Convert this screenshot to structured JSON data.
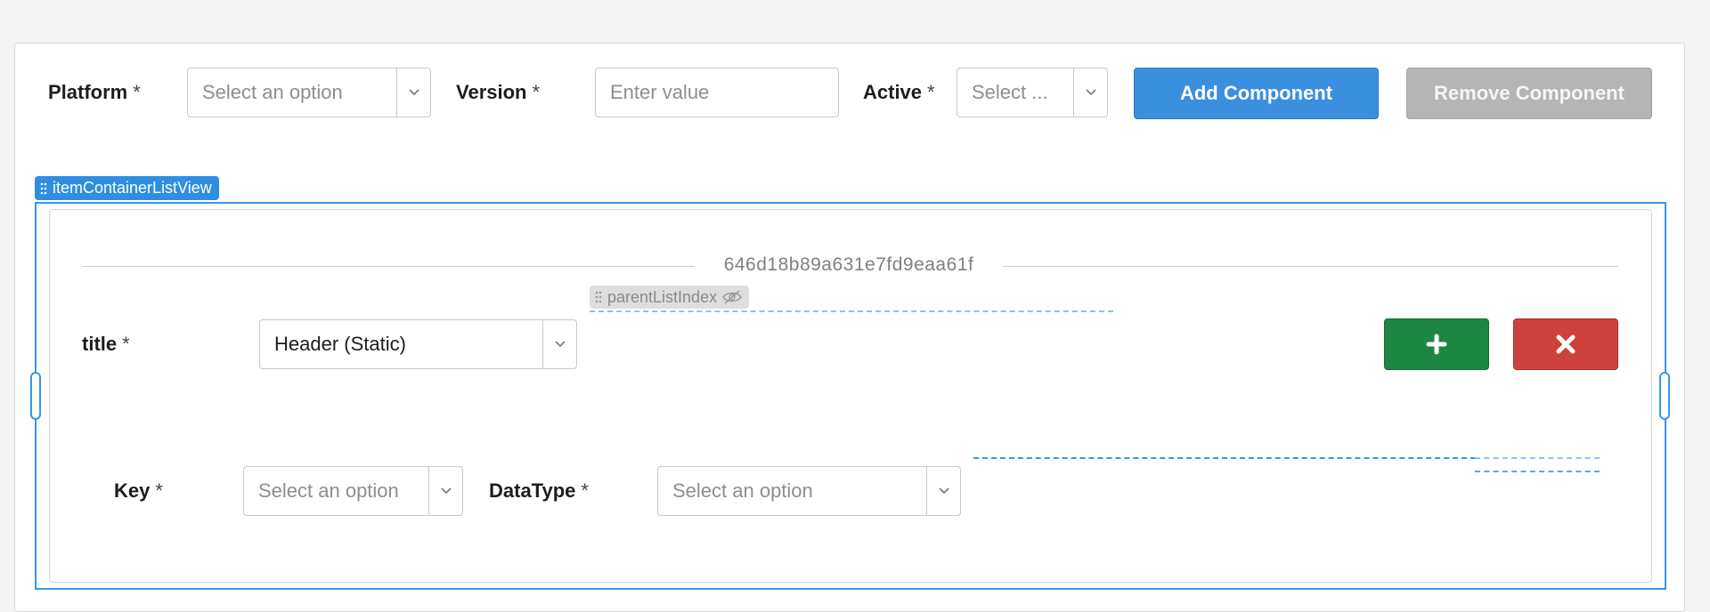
{
  "header": {
    "platform": {
      "label": "Platform",
      "required": "*",
      "placeholder": "Select an option"
    },
    "version": {
      "label": "Version",
      "required": "*",
      "placeholder": "Enter value"
    },
    "active": {
      "label": "Active",
      "required": "*",
      "placeholder": "Select ..."
    },
    "add_component_label": "Add Component",
    "remove_component_label": "Remove Component"
  },
  "list_view": {
    "tag": "itemContainerListView",
    "item": {
      "id": "646d18b89a631e7fd9eaa61f",
      "parent_tag": "parentListIndex",
      "title": {
        "label": "title",
        "required": "*",
        "value": "Header (Static)"
      },
      "key": {
        "label": "Key",
        "required": "*",
        "placeholder": "Select an option"
      },
      "datatype": {
        "label": "DataType",
        "required": "*",
        "placeholder": "Select an option"
      }
    }
  },
  "colors": {
    "primary": "#3a8fdf",
    "disabled": "#b5b5b5",
    "success": "#1d8742",
    "danger": "#cd423c",
    "selection": "#3a95e4"
  },
  "icons": [
    "chevron-down-icon",
    "drag-handle-icon",
    "eye-off-icon",
    "plus-icon",
    "close-icon"
  ]
}
